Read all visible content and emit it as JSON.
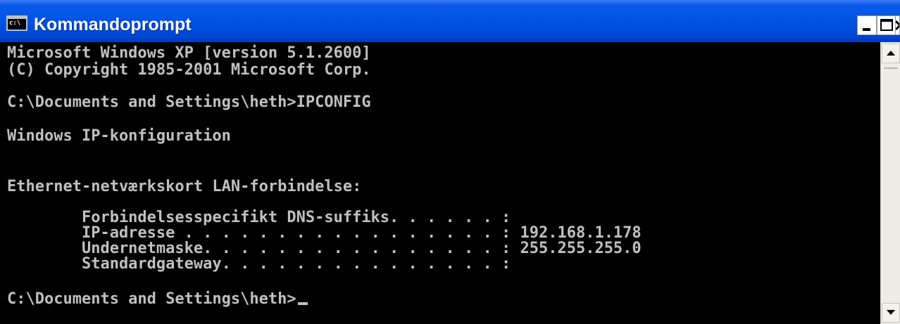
{
  "window": {
    "title": "Kommandoprompt",
    "icon_text": "c:\\",
    "icon": "console-icon",
    "minimize_icon": "minimize-icon",
    "maximize_icon": "maximize-icon",
    "close_icon": "close-icon"
  },
  "console": {
    "lines": [
      "Microsoft Windows XP [version 5.1.2600]",
      "(C) Copyright 1985-2001 Microsoft Corp.",
      "C:\\Documents and Settings\\heth>IPCONFIG",
      "Windows IP-konfiguration",
      "Ethernet-netværkskort LAN-forbindelse:",
      "        Forbindelsesspecifikt DNS-suffiks. . . . . . :",
      "        IP-adresse . . . . . . . . . . . . . . . . . : 192.168.1.178",
      "        Undernetmaske. . . . . . . . . . . . . . . . : 255.255.255.0",
      "        Standardgateway. . . . . . . . . . . . . . . :",
      "C:\\Documents and Settings\\heth>"
    ]
  },
  "scrollbar": {
    "up_icon": "scroll-up-arrow-icon",
    "down_icon": "scroll-down-arrow-icon"
  },
  "colors": {
    "titlebar": "#0055e5",
    "console_bg": "#000000",
    "console_text": "#c0c0c0"
  }
}
